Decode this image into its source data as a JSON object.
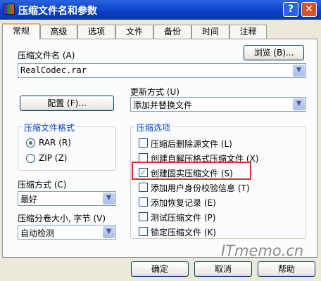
{
  "window": {
    "title": "压缩文件名和参数",
    "help_btn": "?",
    "close_btn": "✕"
  },
  "tabs": [
    "常规",
    "高级",
    "选项",
    "文件",
    "备份",
    "时间",
    "注释"
  ],
  "archive": {
    "label": "压缩文件名 (A)",
    "value": "RealCodec.rar",
    "browse": "浏览 (B)..."
  },
  "profiles_btn": "配置 (F)...",
  "update": {
    "label": "更新方式 (U)",
    "value": "添加并替换文件"
  },
  "format": {
    "title": "压缩文件格式",
    "rar": "RAR (R)",
    "zip": "ZIP (Z)",
    "selected": "RAR"
  },
  "method": {
    "label": "压缩方式 (C)",
    "value": "最好"
  },
  "split": {
    "label": "压缩分卷大小, 字节 (V)",
    "value": "自动检测"
  },
  "options": {
    "title": "压缩选项",
    "items": [
      {
        "label": "压缩后删除源文件 (L)",
        "checked": false
      },
      {
        "label": "创建自解压格式压缩文件 (X)",
        "checked": false
      },
      {
        "label": "创建固实压缩文件 (S)",
        "checked": true
      },
      {
        "label": "添加用户身份校验信息 (T)",
        "checked": false
      },
      {
        "label": "添加恢复记录 (E)",
        "checked": false
      },
      {
        "label": "测试压缩文件 (P)",
        "checked": false
      },
      {
        "label": "锁定压缩文件 (K)",
        "checked": false
      }
    ]
  },
  "watermark": "ITmemo.cn",
  "buttons": {
    "ok": "确定",
    "cancel": "取消",
    "help": "帮助"
  }
}
